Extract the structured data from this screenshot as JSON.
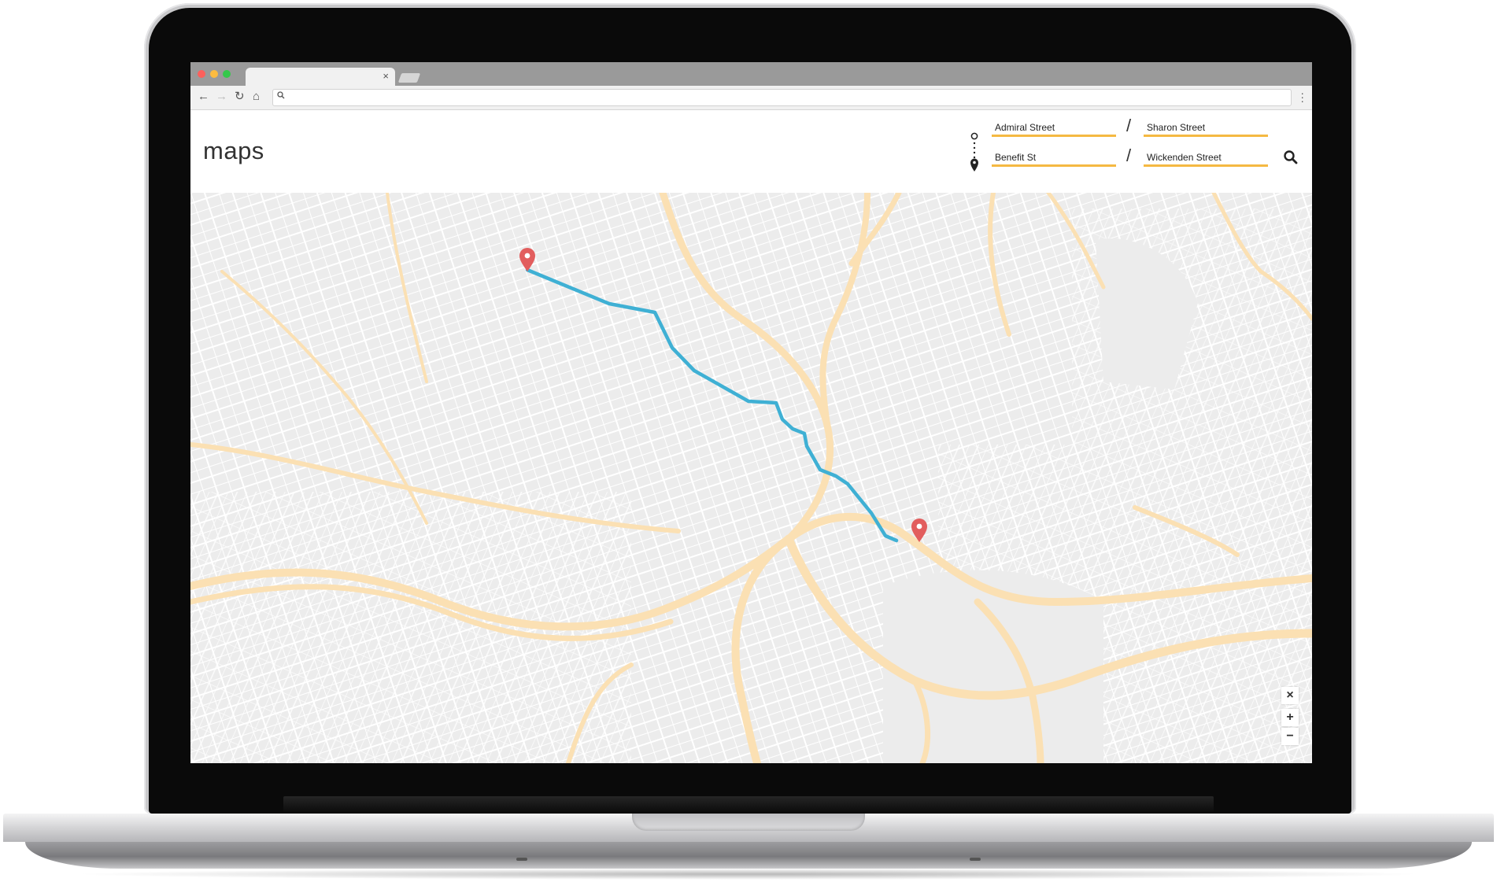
{
  "browser": {
    "tab_close": "×",
    "nav": {
      "back": "←",
      "forward": "→",
      "reload": "↻",
      "home": "⌂"
    },
    "omnibox_icon": "search-icon",
    "menu_icon": "kebab-icon",
    "traffic_colors": [
      "#fc605c",
      "#fdbc40",
      "#34c84a"
    ]
  },
  "app": {
    "logo": "maps",
    "route": {
      "origin": {
        "street": "Admiral Street",
        "cross_street": "Sharon Street"
      },
      "destination": {
        "street": "Benefit St",
        "cross_street": "Wickenden Street"
      },
      "separator": "/"
    },
    "search_icon": "search-icon",
    "accent_color": "#f5b942"
  },
  "map": {
    "route_color": "#3fb0d4",
    "marker_color": "#e25d5d",
    "road_color": "#fbe0b3",
    "controls": {
      "close": "×",
      "zoom_in": "+",
      "zoom_out": "−"
    }
  }
}
